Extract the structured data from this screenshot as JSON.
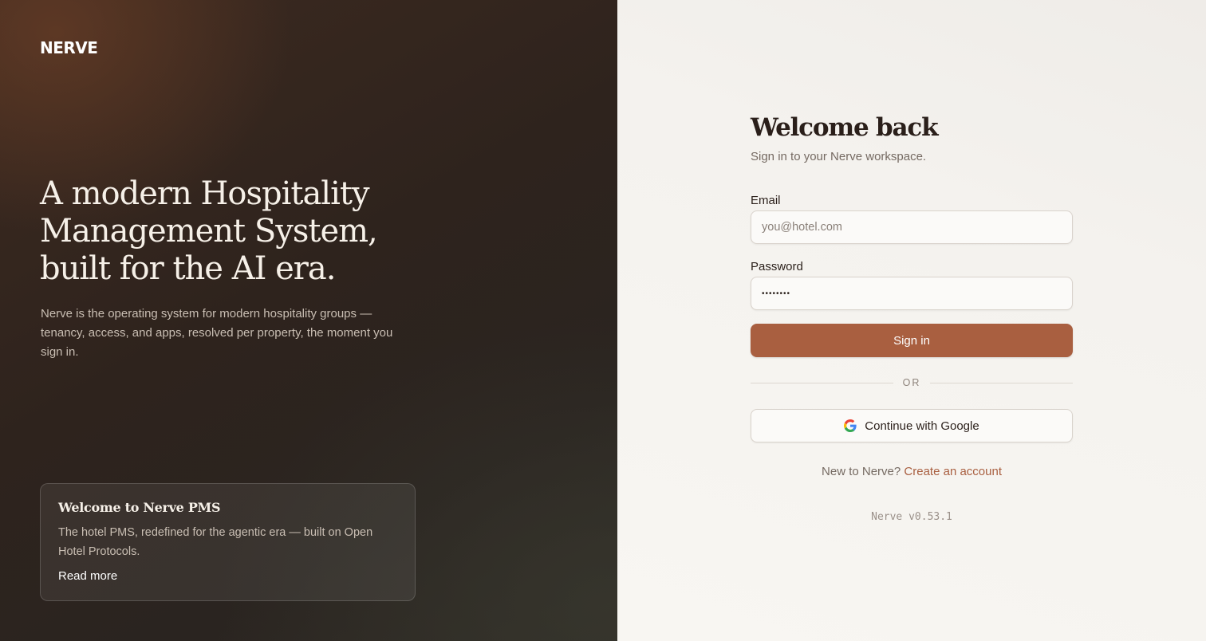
{
  "brand": {
    "logo_text": "NERVE"
  },
  "hero": {
    "title": "A modern Hospitality Management System, built for the AI era.",
    "subtitle": "Nerve is the operating system for modern hospitality groups — tenancy, access, and apps, resolved per property, the moment you sign in."
  },
  "announcement": {
    "title": "Welcome to Nerve PMS",
    "body": "The hotel PMS, redefined for the agentic era — built on Open Hotel Protocols.",
    "link_label": "Read more"
  },
  "login": {
    "heading": "Welcome back",
    "subheading": "Sign in to your Nerve workspace.",
    "email_label": "Email",
    "email_placeholder": "you@hotel.com",
    "email_value": "",
    "password_label": "Password",
    "password_value": "••••••••",
    "sign_in_label": "Sign in",
    "divider_label": "OR",
    "google_label": "Continue with Google",
    "google_icon": "google-icon",
    "signup_prompt": "New to Nerve?",
    "signup_link": "Create an account",
    "version": "Nerve v0.53.1"
  },
  "colors": {
    "accent": "#a95f40",
    "left_panel_dark": "#2e231d",
    "right_panel_bg": "#f6f4f0"
  }
}
